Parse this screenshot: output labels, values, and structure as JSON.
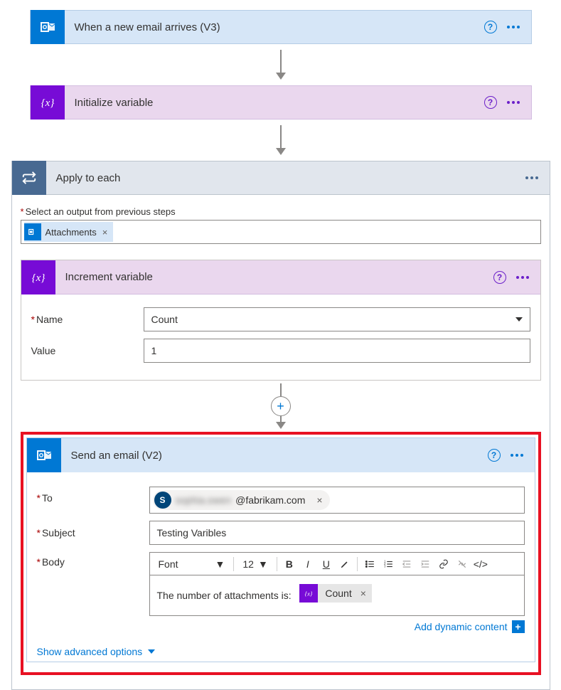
{
  "steps": {
    "trigger": {
      "title": "When a new email arrives (V3)"
    },
    "init_var": {
      "title": "Initialize variable"
    },
    "loop": {
      "title": "Apply to each",
      "select_label": "Select an output from previous steps",
      "token_label": "Attachments"
    },
    "increment": {
      "title": "Increment variable",
      "name_label": "Name",
      "name_value": "Count",
      "value_label": "Value",
      "value_value": "1"
    },
    "send": {
      "title": "Send an email (V2)",
      "to_label": "To",
      "to_avatar": "S",
      "to_name_masked": "sophia.owen",
      "to_domain": "@fabrikam.com",
      "subject_label": "Subject",
      "subject_value": "Testing Varibles",
      "body_label": "Body",
      "font_label": "Font",
      "font_size": "12",
      "body_text_prefix": "The number of attachments is:",
      "var_token": "Count",
      "dyn_link": "Add dynamic content",
      "adv_link": "Show advanced options"
    }
  }
}
